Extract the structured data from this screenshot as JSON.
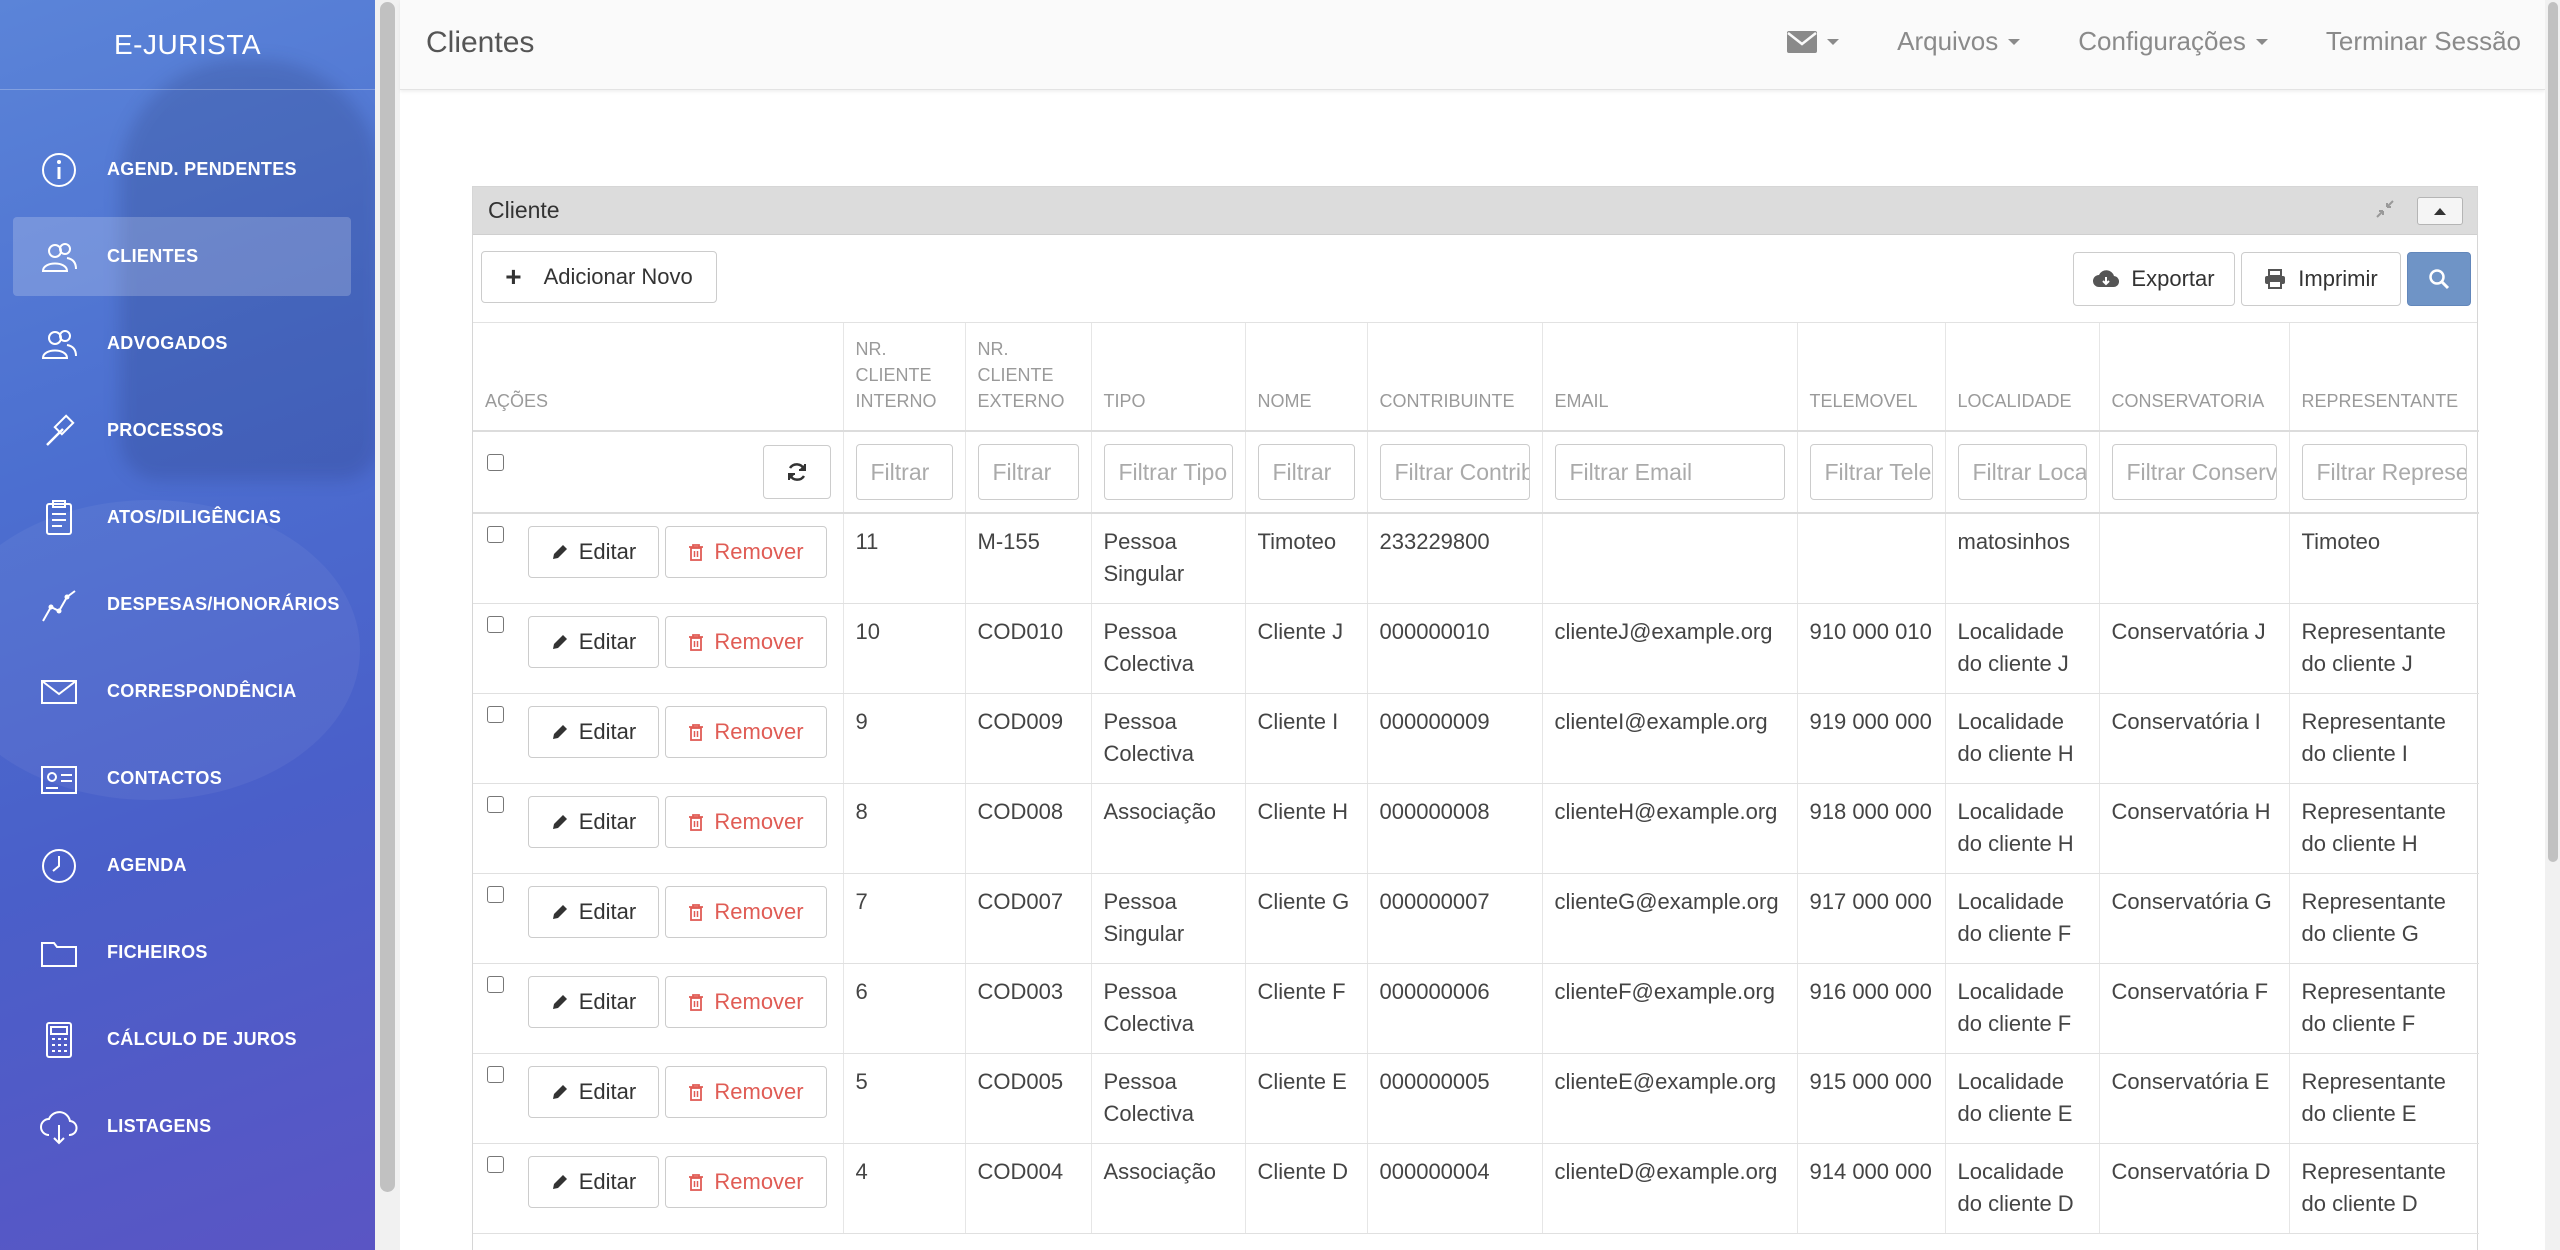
{
  "brand": "E-JURISTA",
  "sidebar": {
    "items": [
      {
        "label": "AGEND. PENDENTES",
        "icon": "info-icon",
        "active": false
      },
      {
        "label": "CLIENTES",
        "icon": "users-icon",
        "active": true
      },
      {
        "label": "ADVOGADOS",
        "icon": "users-icon",
        "active": false
      },
      {
        "label": "PROCESSOS",
        "icon": "gavel-icon",
        "active": false
      },
      {
        "label": "ATOS/DILIGÊNCIAS",
        "icon": "clipboard-icon",
        "active": false
      },
      {
        "label": "DESPESAS/HONORÁRIOS",
        "icon": "chart-line-icon",
        "active": false
      },
      {
        "label": "CORRESPONDÊNCIA",
        "icon": "envelope-icon",
        "active": false
      },
      {
        "label": "CONTACTOS",
        "icon": "address-card-icon",
        "active": false
      },
      {
        "label": "AGENDA",
        "icon": "clock-icon",
        "active": false
      },
      {
        "label": "FICHEIROS",
        "icon": "folder-icon",
        "active": false
      },
      {
        "label": "CÁLCULO DE JUROS",
        "icon": "calculator-icon",
        "active": false
      },
      {
        "label": "LISTAGENS",
        "icon": "cloud-download-icon",
        "active": false
      }
    ]
  },
  "header": {
    "title": "Clientes",
    "menu": {
      "files": "Arquivos",
      "settings": "Configurações",
      "logout": "Terminar Sessão"
    }
  },
  "panel": {
    "title": "Cliente",
    "add_label": "Adicionar Novo",
    "export_label": "Exportar",
    "print_label": "Imprimir"
  },
  "table": {
    "columns": [
      "AÇÕES",
      "NR. CLIENTE INTERNO",
      "NR. CLIENTE EXTERNO",
      "TIPO",
      "NOME",
      "CONTRIBUINTE",
      "EMAIL",
      "TELEMOVEL",
      "LOCALIDADE",
      "CONSERVATORIA",
      "REPRESENTANTE"
    ],
    "filters": [
      "Filtrar",
      "Filtrar",
      "Filtrar Tipo",
      "Filtrar",
      "Filtrar Contribuinte",
      "Filtrar Email",
      "Filtrar Telemovel",
      "Filtrar Localidade",
      "Filtrar Conservatoria",
      "Filtrar Representante"
    ],
    "edit_label": "Editar",
    "remove_label": "Remover",
    "rows": [
      [
        "11",
        "M-155",
        "Pessoa Singular",
        "Timoteo",
        "233229800",
        "",
        "",
        "matosinhos",
        "",
        "Timoteo"
      ],
      [
        "10",
        "COD010",
        "Pessoa Colectiva",
        "Cliente J",
        "000000010",
        "clienteJ@example.org",
        "910 000 010",
        "Localidade do cliente J",
        "Conservatória J",
        "Representante do cliente J"
      ],
      [
        "9",
        "COD009",
        "Pessoa Colectiva",
        "Cliente I",
        "000000009",
        "clienteI@example.org",
        "919 000 000",
        "Localidade do cliente H",
        "Conservatória I",
        "Representante do cliente I"
      ],
      [
        "8",
        "COD008",
        "Associação",
        "Cliente H",
        "000000008",
        "clienteH@example.org",
        "918 000 000",
        "Localidade do cliente H",
        "Conservatória H",
        "Representante do cliente H"
      ],
      [
        "7",
        "COD007",
        "Pessoa Singular",
        "Cliente G",
        "000000007",
        "clienteG@example.org",
        "917 000 000",
        "Localidade do cliente F",
        "Conservatória G",
        "Representante do cliente G"
      ],
      [
        "6",
        "COD003",
        "Pessoa Colectiva",
        "Cliente F",
        "000000006",
        "clienteF@example.org",
        "916 000 000",
        "Localidade do cliente F",
        "Conservatória F",
        "Representante do cliente F"
      ],
      [
        "5",
        "COD005",
        "Pessoa Colectiva",
        "Cliente E",
        "000000005",
        "clienteE@example.org",
        "915 000 000",
        "Localidade do cliente E",
        "Conservatória E",
        "Representante do cliente E"
      ],
      [
        "4",
        "COD004",
        "Associação",
        "Cliente D",
        "000000004",
        "clienteD@example.org",
        "914 000 000",
        "Localidade do cliente D",
        "Conservatória D",
        "Representante do cliente D"
      ]
    ]
  }
}
